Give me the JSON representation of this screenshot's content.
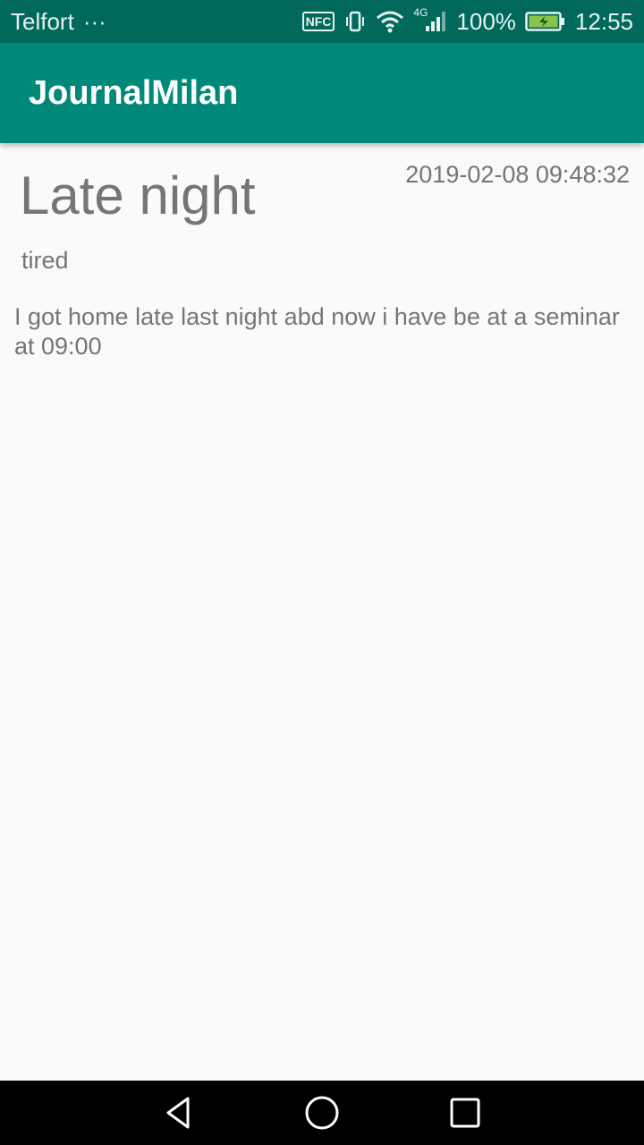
{
  "status_bar": {
    "carrier": "Telfort",
    "more": "···",
    "network": "4G",
    "battery": "100%",
    "time": "12:55",
    "icons": [
      "nfc-icon",
      "vibrate-icon",
      "wifi-icon",
      "signal-icon",
      "battery-charging-icon"
    ]
  },
  "app_bar": {
    "title": "JournalMilan"
  },
  "entry": {
    "title": "Late night",
    "date": "2019-02-08 09:48:32",
    "mood": "tired",
    "body": "I got home late last night abd now i have be at a seminar at 09:00"
  },
  "nav_bar": {
    "icons": [
      "back-icon",
      "home-icon",
      "recents-icon"
    ]
  },
  "colors": {
    "status_bar": "#00695c",
    "app_bar": "#00897b",
    "background": "#fafafa",
    "text": "#757575"
  }
}
